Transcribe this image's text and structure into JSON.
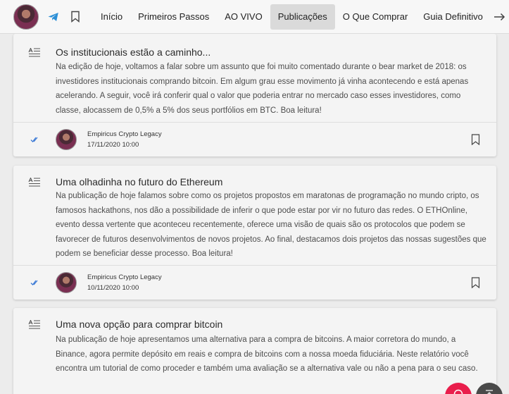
{
  "header": {
    "nav": [
      "Início",
      "Primeiros Passos",
      "AO VIVO",
      "Publicações",
      "O Que Comprar",
      "Guia Definitivo"
    ],
    "active_index": 3,
    "icons": [
      "avatar",
      "telegram-icon",
      "bookmark-icon",
      "logout-icon"
    ]
  },
  "posts": [
    {
      "title": "Os institucionais estão a caminho...",
      "body": "Na edição de hoje, voltamos a falar sobre um assunto que foi muito comentado durante o bear market de 2018: os investidores institucionais comprando bitcoin. Em algum grau esse movimento já vinha acontecendo e está apenas acelerando. A seguir, você irá conferir qual o valor que poderia entrar no mercado caso esses investidores, como classe, alocassem de 0,5% a 5% dos seus portfólios em BTC. Boa leitura!",
      "author": "Empiricus Crypto Legacy",
      "date": "17/11/2020 10:00"
    },
    {
      "title": "Uma olhadinha no futuro do Ethereum",
      "body": "Na publicação de hoje falamos sobre como os projetos propostos em maratonas de programação no mundo cripto, os famosos hackathons, nos dão a possibilidade de inferir o que pode estar por vir no futuro das redes. O ETHOnline, evento dessa vertente que aconteceu recentemente, oferece uma visão de quais são os protocolos que podem se favorecer de futuros desenvolvimentos de novos projetos. Ao final, destacamos dois projetos das nossas sugestões que podem se beneficiar desse processo. Boa leitura!",
      "author": "Empiricus Crypto Legacy",
      "date": "10/11/2020 10:00"
    },
    {
      "title": "Uma nova opção para comprar bitcoin",
      "body": "Na publicação de hoje apresentamos uma alternativa para a compra de bitcoins. A maior corretora do mundo, a Binance, agora permite depósito em reais e compra de bitcoins com a nossa moeda fiduciária. Neste relatório você encontra um tutorial de como proceder e também uma avaliação se a alternativa vale ou não a pena para o seu caso."
    }
  ],
  "colors": {
    "accent_red": "#e91e4c",
    "check_blue": "#3d7bd6",
    "active_tab_bg": "#dadada"
  }
}
